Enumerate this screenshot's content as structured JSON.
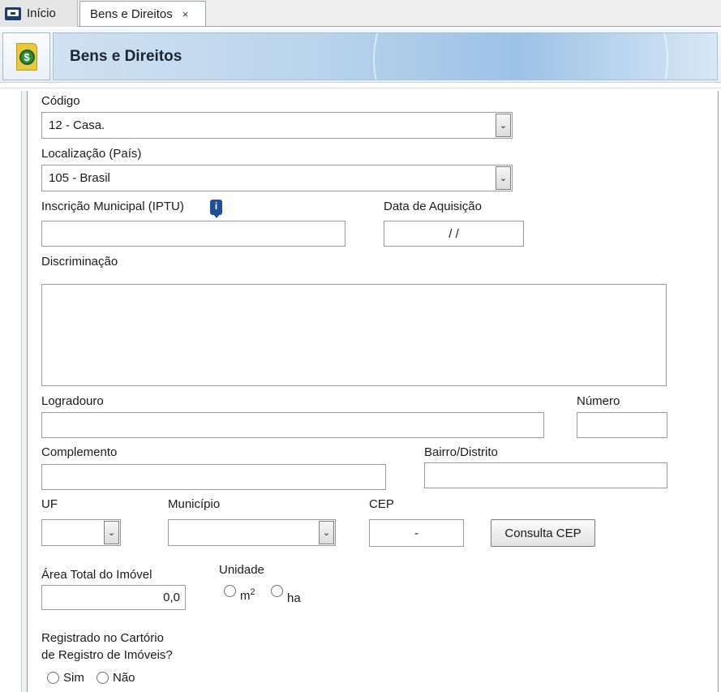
{
  "tabs": {
    "home_label": "Início",
    "active_label": "Bens e Direitos",
    "close_glyph": "×"
  },
  "header": {
    "title": "Bens e Direitos",
    "icon_glyph": "$"
  },
  "form": {
    "codigo": {
      "label": "Código",
      "value": "12 - Casa."
    },
    "localizacao": {
      "label": "Localização (País)",
      "value": "105 - Brasil"
    },
    "iptu": {
      "label": "Inscrição Municipal (IPTU)",
      "value": "",
      "info_glyph": "i"
    },
    "data_aquisicao": {
      "label": "Data de Aquisição",
      "value": "/ /"
    },
    "discriminacao": {
      "label": "Discriminação",
      "value": ""
    },
    "logradouro": {
      "label": "Logradouro",
      "value": ""
    },
    "numero": {
      "label": "Número",
      "value": ""
    },
    "complemento": {
      "label": "Complemento",
      "value": ""
    },
    "bairro": {
      "label": "Bairro/Distrito",
      "value": ""
    },
    "uf": {
      "label": "UF",
      "value": ""
    },
    "municipio": {
      "label": "Município",
      "value": ""
    },
    "cep": {
      "label": "CEP",
      "value": "-"
    },
    "consulta_cep": {
      "label": "Consulta CEP"
    },
    "area_total": {
      "label": "Área Total do Imóvel",
      "value": "0,0"
    },
    "unidade": {
      "label": "Unidade",
      "option_m2": "m",
      "option_m2_sup": "2",
      "option_ha": "ha"
    },
    "registrado": {
      "label_line1": "Registrado no Cartório",
      "label_line2": "de Registro de Imóveis?",
      "option_sim": "Sim",
      "option_nao": "Não"
    }
  },
  "select_arrow_glyph": "⌄"
}
